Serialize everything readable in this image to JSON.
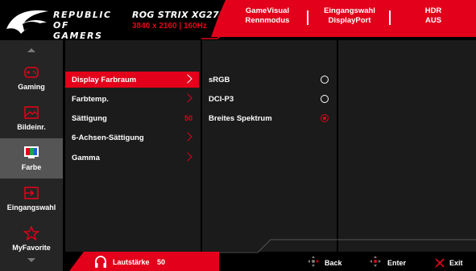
{
  "header": {
    "brand_line1": "REPUBLIC OF",
    "brand_line2": "GAMERS",
    "model": "ROG STRIX XG27UCSR",
    "resolution": "3840 x 2160 | 160Hz",
    "items": [
      {
        "label": "GameVisual",
        "value": "Rennmodus"
      },
      {
        "label": "Eingangswahl",
        "value": "DisplayPort"
      },
      {
        "label": "HDR",
        "value": "AUS"
      }
    ]
  },
  "sidebar": {
    "items": [
      {
        "label": "Gaming",
        "icon": "gamepad-icon",
        "active": false
      },
      {
        "label": "Bildeinr.",
        "icon": "image-icon",
        "active": false
      },
      {
        "label": "Farbe",
        "icon": "color-bars-icon",
        "active": true
      },
      {
        "label": "Eingangswahl",
        "icon": "input-icon",
        "active": false
      },
      {
        "label": "MyFavorite",
        "icon": "star-icon",
        "active": false
      }
    ]
  },
  "submenu": {
    "items": [
      {
        "label": "Display Farbraum",
        "value": "",
        "selected": true
      },
      {
        "label": "Farbtemp.",
        "value": "",
        "selected": false
      },
      {
        "label": "Sättigung",
        "value": "50",
        "selected": false
      },
      {
        "label": "6-Achsen-Sättigung",
        "value": "",
        "selected": false
      },
      {
        "label": "Gamma",
        "value": "",
        "selected": false
      }
    ]
  },
  "options": {
    "items": [
      {
        "label": "sRGB",
        "checked": false
      },
      {
        "label": "DCI-P3",
        "checked": false
      },
      {
        "label": "Breites Spektrum",
        "checked": true
      }
    ]
  },
  "footer": {
    "volume_label": "Lautstärke",
    "volume_value": "50",
    "back_label": "Back",
    "enter_label": "Enter",
    "exit_label": "Exit"
  },
  "colors": {
    "accent": "#e2001a",
    "panel": "#1b1b1b",
    "sidebar": "#252525",
    "active": "#555555"
  }
}
